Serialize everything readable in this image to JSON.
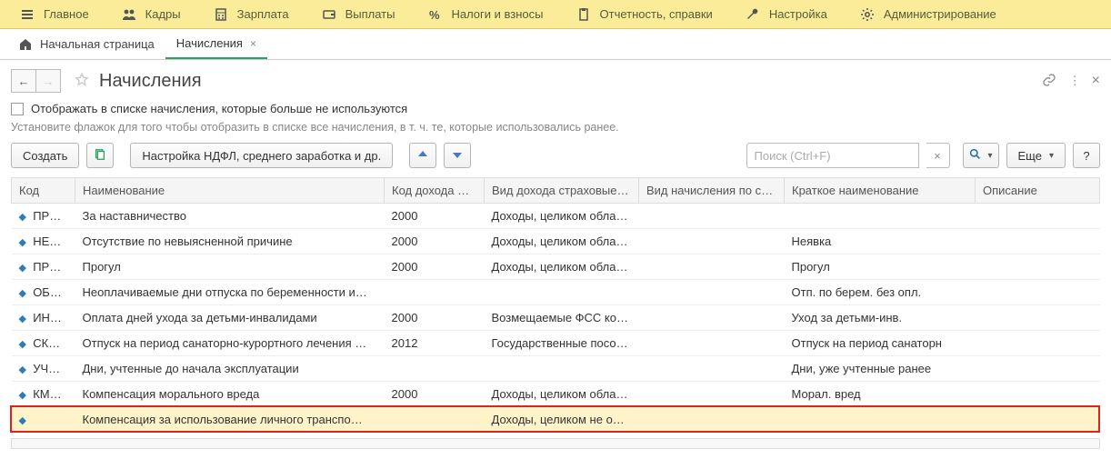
{
  "topmenu": [
    {
      "id": "main",
      "label": "Главное",
      "icon": "menu"
    },
    {
      "id": "hr",
      "label": "Кадры",
      "icon": "people"
    },
    {
      "id": "salary",
      "label": "Зарплата",
      "icon": "calc"
    },
    {
      "id": "pay",
      "label": "Выплаты",
      "icon": "wallet"
    },
    {
      "id": "tax",
      "label": "Налоги и взносы",
      "icon": "percent"
    },
    {
      "id": "report",
      "label": "Отчетность, справки",
      "icon": "clipboard"
    },
    {
      "id": "settings",
      "label": "Настройка",
      "icon": "wrench"
    },
    {
      "id": "admin",
      "label": "Администрирование",
      "icon": "gear"
    }
  ],
  "tabs": {
    "home_label": "Начальная страница",
    "active_label": "Начисления"
  },
  "page": {
    "title": "Начисления"
  },
  "filter": {
    "checkbox_label": "Отображать в списке начисления, которые больше не используются",
    "hint": "Установите флажок для того чтобы отобразить в списке все начисления, в т. ч. те, которые использовались ранее."
  },
  "toolbar": {
    "create_label": "Создать",
    "ndfl_label": "Настройка НДФЛ, среднего заработка и др.",
    "more_label": "Еще",
    "help_label": "?",
    "search_placeholder": "Поиск (Ctrl+F)"
  },
  "columns": {
    "code": "Код",
    "name": "Наименование",
    "income_code": "Код дохода …",
    "insurance": "Вид дохода страховые…",
    "calc_type": "Вид начисления по ст…",
    "short": "Краткое наименование",
    "desc": "Описание"
  },
  "rows": [
    {
      "code": "ПР…",
      "name": "За наставничество",
      "income_code": "2000",
      "insurance": "Доходы, целиком обла…",
      "calc_type": "",
      "short": "",
      "desc": ""
    },
    {
      "code": "НЕ…",
      "name": "Отсутствие по невыясненной причине",
      "income_code": "2000",
      "insurance": "Доходы, целиком обла…",
      "calc_type": "",
      "short": "Неявка",
      "desc": ""
    },
    {
      "code": "ПР…",
      "name": "Прогул",
      "income_code": "2000",
      "insurance": "Доходы, целиком обла…",
      "calc_type": "",
      "short": "Прогул",
      "desc": ""
    },
    {
      "code": "ОБ…",
      "name": "Неоплачиваемые дни отпуска по беременности и…",
      "income_code": "",
      "insurance": "",
      "calc_type": "",
      "short": "Отп. по берем. без опл.",
      "desc": ""
    },
    {
      "code": "ИН…",
      "name": "Оплата дней ухода за детьми-инвалидами",
      "income_code": "2000",
      "insurance": "Возмещаемые ФСС ко…",
      "calc_type": "",
      "short": "Уход за детьми-инв.",
      "desc": ""
    },
    {
      "code": "СК…",
      "name": "Отпуск на период санаторно-курортного лечения …",
      "income_code": "2012",
      "insurance": "Государственные посо…",
      "calc_type": "",
      "short": "Отпуск на период санаторн",
      "desc": ""
    },
    {
      "code": "УЧ…",
      "name": "Дни, учтенные до начала эксплуатации",
      "income_code": "",
      "insurance": "",
      "calc_type": "",
      "short": "Дни, уже учтенные ранее",
      "desc": ""
    },
    {
      "code": "КМ…",
      "name": "Компенсация морального вреда",
      "income_code": "2000",
      "insurance": "Доходы, целиком обла…",
      "calc_type": "",
      "short": "Морал. вред",
      "desc": ""
    },
    {
      "code": "",
      "name": "Компенсация за использование личного транспо…",
      "income_code": "",
      "insurance": "Доходы, целиком не о…",
      "calc_type": "",
      "short": "",
      "desc": "",
      "highlighted": true
    }
  ]
}
